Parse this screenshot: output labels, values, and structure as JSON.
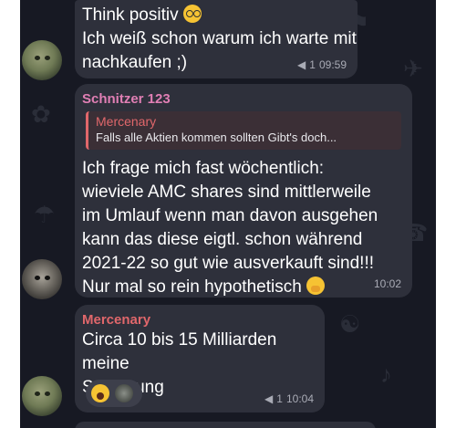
{
  "colors": {
    "background": "#171923",
    "bubble": "#2e303b",
    "sender_pink": "#e07fb4",
    "sender_red": "#e0676b",
    "meta": "#a9abb5"
  },
  "messages": [
    {
      "lines": [
        "Think positiv",
        "Ich weiß schon warum ich warte mit",
        "nachkaufen ;)"
      ],
      "emoji": "nerd-face-emoji",
      "replies": "1",
      "time": "09:59"
    },
    {
      "sender": "Schnitzer 123",
      "quote_author": "Mercenary",
      "quote_text": "Falls alle Aktien kommen sollten Gibt's doch...",
      "lines": [
        "Ich frage mich fast wöchentlich:",
        "wieviele AMC shares sind mittlerweile",
        "im Umlauf wenn man davon ausgehen",
        "kann das diese eigtl. schon während",
        "2021-22 so gut wie ausverkauft sind!!!",
        "Nur mal so rein hypothetisch"
      ],
      "emoji": "face-with-hand-over-mouth-emoji",
      "time": "10:02"
    },
    {
      "sender": "Mercenary",
      "lines": [
        "Circa 10 bis 15 Milliarden meine",
        "Schätzung"
      ],
      "reactions": [
        "screaming-face-emoji",
        "avatar-reaction"
      ],
      "replies": "1",
      "time": "10:04"
    }
  ]
}
